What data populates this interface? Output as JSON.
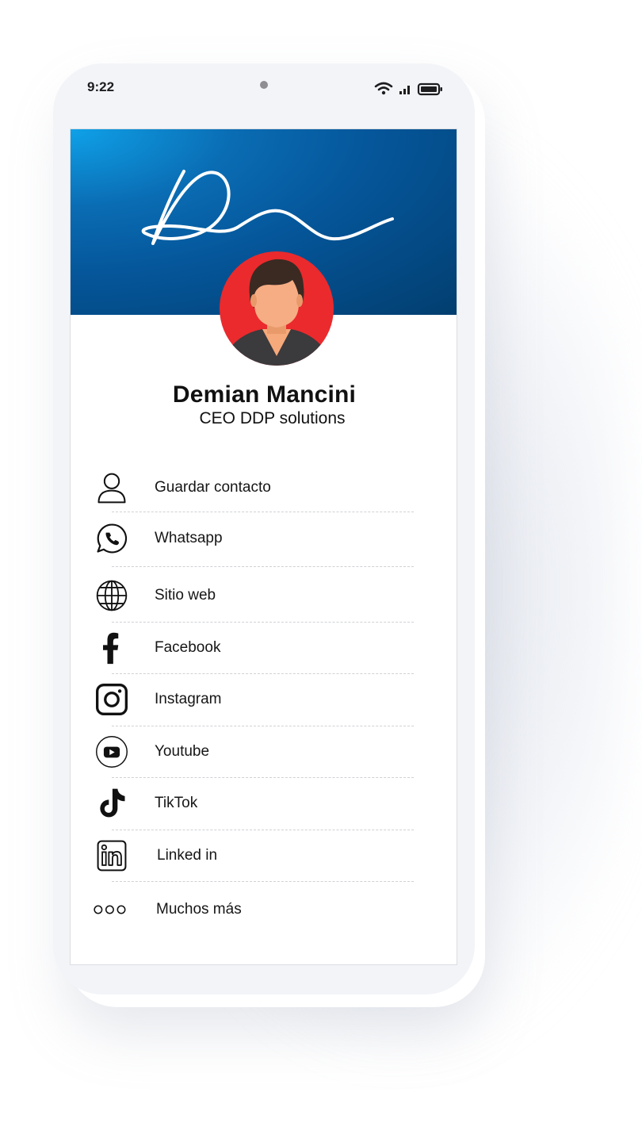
{
  "status_bar": {
    "time": "9:22"
  },
  "profile": {
    "name": "Demian Mancini",
    "title": "CEO DDP solutions"
  },
  "colors": {
    "banner_start": "#0fa1e8",
    "banner_end": "#023e6f",
    "avatar_bg": "#ea2a2d"
  },
  "menu": [
    {
      "label": "Guardar contacto",
      "icon": "person-icon"
    },
    {
      "label": "Whatsapp",
      "icon": "whatsapp-icon"
    },
    {
      "label": "Sitio web",
      "icon": "globe-icon"
    },
    {
      "label": "Facebook",
      "icon": "facebook-icon"
    },
    {
      "label": "Instagram",
      "icon": "instagram-icon"
    },
    {
      "label": "Youtube",
      "icon": "youtube-icon"
    },
    {
      "label": "TikTok",
      "icon": "tiktok-icon"
    },
    {
      "label": "Linked in",
      "icon": "linkedin-icon"
    },
    {
      "label": "Muchos más",
      "icon": "more-dots-icon"
    }
  ]
}
